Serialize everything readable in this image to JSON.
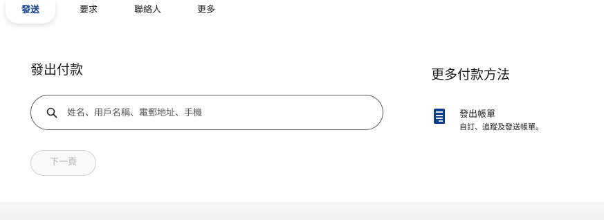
{
  "nav": {
    "tabs": [
      {
        "label": "發送",
        "active": true
      },
      {
        "label": "要求",
        "active": false
      },
      {
        "label": "聯絡人",
        "active": false
      },
      {
        "label": "更多",
        "active": false
      }
    ]
  },
  "send_payment": {
    "title": "發出付款",
    "search": {
      "placeholder": "姓名、用戶名稱、電郵地址、手機",
      "value": ""
    },
    "next_button": "下一頁"
  },
  "more_methods": {
    "title": "更多付款方法",
    "invoice": {
      "title": "發出帳單",
      "description": "自訂、追蹤及發送帳單。",
      "icon": "invoice-icon"
    }
  },
  "colors": {
    "active_tab": "#0c3f8c",
    "icon_blue": "#0c3f8c",
    "disabled_text": "#b5b5b5"
  }
}
